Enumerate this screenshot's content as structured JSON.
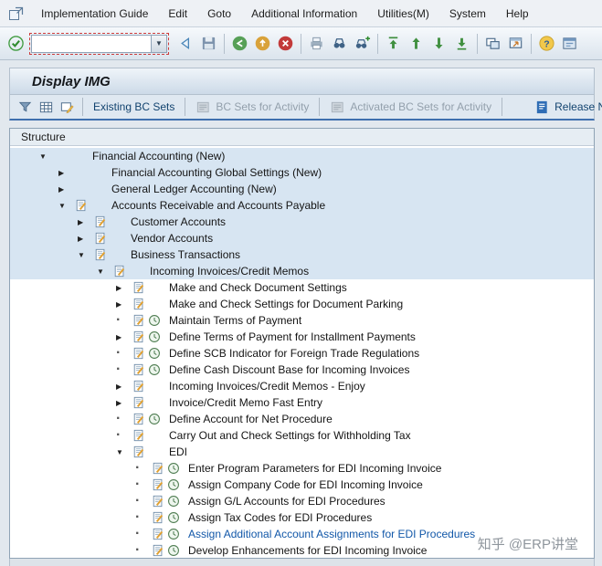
{
  "menu": {
    "items": [
      "Implementation Guide",
      "Edit",
      "Goto",
      "Additional Information",
      "Utilities(M)",
      "System",
      "Help"
    ]
  },
  "toolbar": {
    "command_field": {
      "value": "",
      "placeholder": ""
    },
    "icon_names": [
      "enter",
      "command-dropdown",
      "back",
      "save",
      "back-circle",
      "exit-circle",
      "cancel",
      "print",
      "find",
      "find-next",
      "first-page",
      "page-up",
      "page-down",
      "last-page",
      "new-session",
      "shortcut",
      "help",
      "customize"
    ]
  },
  "title": "Display IMG",
  "app_toolbar": {
    "icon_names": [
      "filter",
      "table",
      "display-change"
    ],
    "buttons": [
      {
        "label": "Existing BC Sets",
        "enabled": true
      },
      {
        "label": "BC Sets for Activity",
        "enabled": false
      },
      {
        "label": "Activated BC Sets for Activity",
        "enabled": false
      },
      {
        "label": "Release Notes",
        "enabled": true
      }
    ]
  },
  "structure_panel": {
    "header": "Structure"
  },
  "tree": {
    "rows": [
      {
        "level": 0,
        "expander": "open",
        "icons": [],
        "label": "Financial Accounting (New)",
        "highlighted": true
      },
      {
        "level": 1,
        "expander": "closed",
        "icons": [],
        "label": "Financial Accounting Global Settings (New)",
        "highlighted": true
      },
      {
        "level": 1,
        "expander": "closed",
        "icons": [],
        "label": "General Ledger Accounting (New)",
        "highlighted": true
      },
      {
        "level": 1,
        "expander": "open",
        "icons": [
          "activity"
        ],
        "label": "Accounts Receivable and Accounts Payable",
        "highlighted": true
      },
      {
        "level": 2,
        "expander": "closed",
        "icons": [
          "activity"
        ],
        "label": "Customer Accounts",
        "highlighted": true
      },
      {
        "level": 2,
        "expander": "closed",
        "icons": [
          "activity"
        ],
        "label": "Vendor Accounts",
        "highlighted": true
      },
      {
        "level": 2,
        "expander": "open",
        "icons": [
          "activity"
        ],
        "label": "Business Transactions",
        "highlighted": true
      },
      {
        "level": 3,
        "expander": "open",
        "icons": [
          "activity"
        ],
        "label": "Incoming Invoices/Credit Memos",
        "highlighted": true
      },
      {
        "level": 4,
        "expander": "closed",
        "icons": [
          "activity"
        ],
        "label": "Make and Check Document Settings"
      },
      {
        "level": 4,
        "expander": "closed",
        "icons": [
          "activity"
        ],
        "label": "Make and Check Settings for Document Parking"
      },
      {
        "level": 4,
        "expander": "leaf",
        "icons": [
          "activity",
          "clock"
        ],
        "label": "Maintain Terms of Payment"
      },
      {
        "level": 4,
        "expander": "closed",
        "icons": [
          "activity",
          "clock"
        ],
        "label": "Define Terms of Payment for Installment Payments"
      },
      {
        "level": 4,
        "expander": "leaf",
        "icons": [
          "activity",
          "clock"
        ],
        "label": "Define SCB Indicator for Foreign Trade Regulations"
      },
      {
        "level": 4,
        "expander": "leaf",
        "icons": [
          "activity",
          "clock"
        ],
        "label": "Define Cash Discount Base for Incoming Invoices"
      },
      {
        "level": 4,
        "expander": "closed",
        "icons": [
          "activity"
        ],
        "label": "Incoming Invoices/Credit Memos - Enjoy"
      },
      {
        "level": 4,
        "expander": "closed",
        "icons": [
          "activity"
        ],
        "label": "Invoice/Credit Memo Fast Entry"
      },
      {
        "level": 4,
        "expander": "leaf",
        "icons": [
          "activity",
          "clock"
        ],
        "label": "Define Account for Net Procedure"
      },
      {
        "level": 4,
        "expander": "leaf",
        "icons": [
          "activity"
        ],
        "label": "Carry Out and Check Settings for Withholding Tax"
      },
      {
        "level": 4,
        "expander": "open",
        "icons": [
          "activity"
        ],
        "label": "EDI"
      },
      {
        "level": 5,
        "expander": "leaf",
        "icons": [
          "activity",
          "clock"
        ],
        "label": "Enter Program Parameters for EDI Incoming Invoice"
      },
      {
        "level": 5,
        "expander": "leaf",
        "icons": [
          "activity",
          "clock"
        ],
        "label": "Assign Company Code for EDI Incoming Invoice"
      },
      {
        "level": 5,
        "expander": "leaf",
        "icons": [
          "activity",
          "clock"
        ],
        "label": "Assign G/L Accounts for EDI Procedures"
      },
      {
        "level": 5,
        "expander": "leaf",
        "icons": [
          "activity",
          "clock"
        ],
        "label": "Assign Tax Codes for EDI Procedures"
      },
      {
        "level": 5,
        "expander": "leaf",
        "icons": [
          "activity",
          "clock"
        ],
        "label": "Assign Additional Account Assignments for EDI Procedures",
        "selected": true
      },
      {
        "level": 5,
        "expander": "leaf",
        "icons": [
          "activity",
          "clock"
        ],
        "label": "Develop Enhancements for EDI Incoming Invoice"
      }
    ]
  },
  "watermark": "知乎 @ERP讲堂"
}
